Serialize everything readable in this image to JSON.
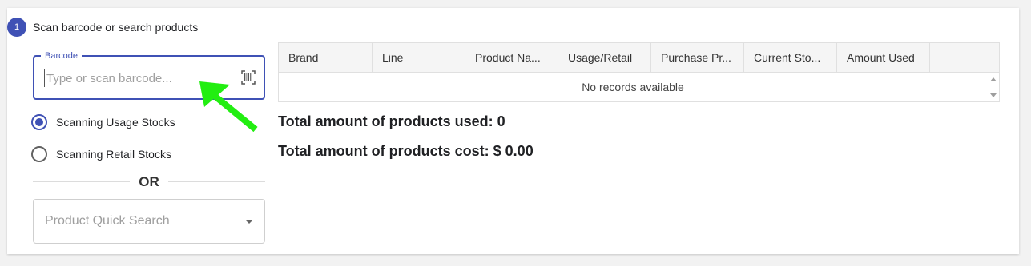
{
  "step": {
    "number": "1",
    "title": "Scan barcode or search products"
  },
  "barcode": {
    "label": "Barcode",
    "placeholder": "Type or scan barcode...",
    "value": ""
  },
  "scan_modes": [
    {
      "label": "Scanning Usage Stocks",
      "checked": true
    },
    {
      "label": "Scanning Retail Stocks",
      "checked": false
    }
  ],
  "divider": {
    "text": "OR"
  },
  "quick_search": {
    "placeholder": "Product Quick Search"
  },
  "table": {
    "columns": [
      "Brand",
      "Line",
      "Product Na...",
      "Usage/Retail",
      "Purchase Pr...",
      "Current Sto...",
      "Amount Used"
    ],
    "empty_text": "No records available"
  },
  "summary": {
    "used_label": "Total amount of products used: 0",
    "cost_label": "Total amount of products cost: $ 0.00"
  },
  "colors": {
    "accent": "#3f51b5",
    "annotation_arrow": "#22ee11"
  },
  "icons": {
    "scan": "barcode-scan-icon",
    "dropdown": "chevron-down-icon"
  }
}
